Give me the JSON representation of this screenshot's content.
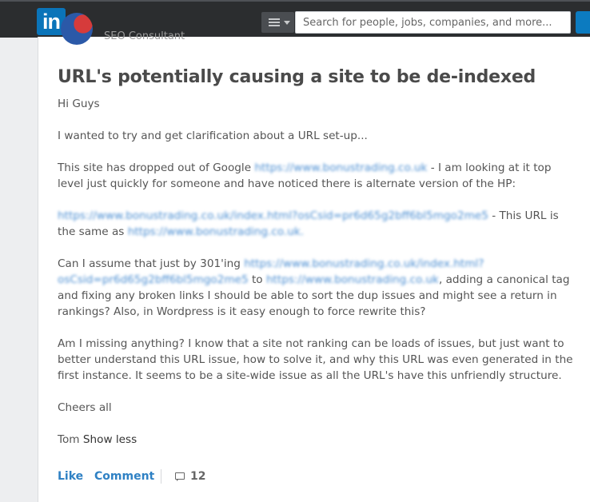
{
  "header": {
    "logo_text": "in",
    "logo_mark": "®",
    "menu_icon": "hamburger-menu-icon",
    "search": {
      "placeholder": "Search for people, jobs, companies, and more..."
    }
  },
  "post": {
    "author_subtitle": "SEO Consultant",
    "title": "URL's potentially causing a site to be de-indexed",
    "paragraphs": {
      "p1": "Hi Guys",
      "p2": "I wanted to try and get clarification about a URL set-up...",
      "p3": {
        "t1": "This site has dropped out of Google ",
        "link1": "https://www.bonustrading.co.uk",
        "t2": " - I am looking at it top level just quickly for someone and have noticed there is alternate version of the HP:"
      },
      "p4": {
        "link1": "https://www.bonustrading.co.uk/index.html?osCsid=pr6d65g2bff6bl5mgo2me5",
        "t1": " - This URL is the same as ",
        "link2": "https://www.bonustrading.co.uk."
      },
      "p5": {
        "t1": "Can I assume that just by 301'ing ",
        "link1": "https://www.bonustrading.co.uk/index.html?osCsid=pr6d65g2bff6bl5mgo2me5",
        "t2": " to ",
        "link2": "https://www.bonustrading.co.uk",
        "t3": ", adding a canonical tag and fixing any broken links I should be able to sort the dup issues and might see a return in rankings? Also, in Wordpress is it easy enough to force rewrite this?"
      },
      "p6": "Am I missing anything? I know that a site not ranking can be loads of issues, but just want to better understand this URL issue, how to solve it, and why this URL was even generated in the first instance. It seems to be a site-wide issue as all the URL's have this unfriendly structure.",
      "p7": "Cheers all",
      "p8": {
        "name": "Tom",
        "show_less": "Show less"
      }
    },
    "actions": {
      "like": "Like",
      "comment": "Comment",
      "comment_count": "12"
    }
  }
}
